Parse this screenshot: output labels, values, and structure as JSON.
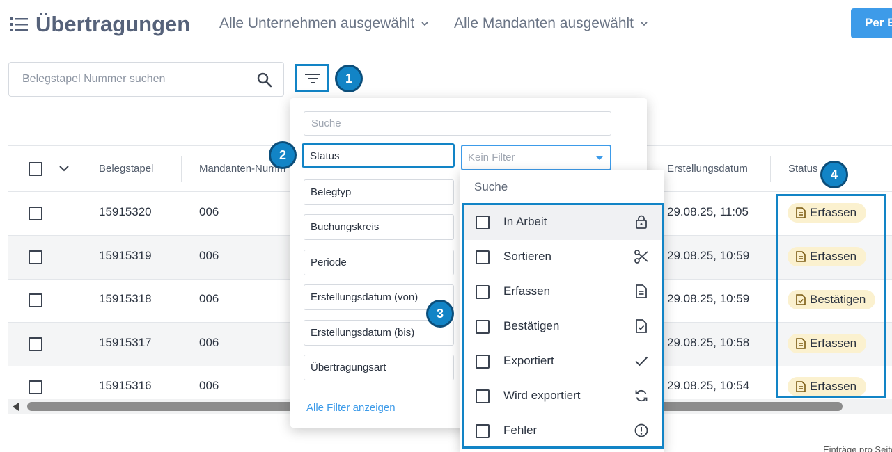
{
  "header": {
    "title": "Übertragungen",
    "company_filter": "Alle Unternehmen ausgewählt",
    "client_filter": "Alle Mandanten ausgewählt",
    "primary_button": "Per E"
  },
  "search": {
    "placeholder": "Belegstapel Nummer suchen"
  },
  "badges": [
    "1",
    "2",
    "3",
    "4"
  ],
  "table": {
    "columns": [
      "Belegstapel",
      "Mandanten-Numm",
      "Erstellungsdatum",
      "Status"
    ],
    "rows": [
      {
        "belegstapel": "15915320",
        "mandant": "006",
        "datum": "29.08.25, 11:05",
        "status": "Erfassen",
        "status_icon": "document-icon"
      },
      {
        "belegstapel": "15915319",
        "mandant": "006",
        "datum": "29.08.25, 10:59",
        "status": "Erfassen",
        "status_icon": "document-icon"
      },
      {
        "belegstapel": "15915318",
        "mandant": "006",
        "datum": "29.08.25, 10:59",
        "status": "Bestätigen",
        "status_icon": "document-check-icon"
      },
      {
        "belegstapel": "15915317",
        "mandant": "006",
        "datum": "29.08.25, 10:58",
        "status": "Erfassen",
        "status_icon": "document-icon"
      },
      {
        "belegstapel": "15915316",
        "mandant": "006",
        "datum": "29.08.25, 10:54",
        "status": "Erfassen",
        "status_icon": "document-icon"
      }
    ]
  },
  "filter_panel": {
    "search_placeholder": "Suche",
    "fields": [
      "Status",
      "Belegtyp",
      "Buchungskreis",
      "Periode",
      "Erstellungsdatum (von)",
      "Erstellungsdatum (bis)",
      "Übertragungsart"
    ],
    "status_select_placeholder": "Kein Filter",
    "show_all_link": "Alle Filter anzeigen"
  },
  "status_dropdown": {
    "search_label": "Suche",
    "options": [
      {
        "label": "In Arbeit",
        "icon": "lock-icon"
      },
      {
        "label": "Sortieren",
        "icon": "scissors-icon"
      },
      {
        "label": "Erfassen",
        "icon": "document-icon"
      },
      {
        "label": "Bestätigen",
        "icon": "document-check-icon"
      },
      {
        "label": "Exportiert",
        "icon": "check-icon"
      },
      {
        "label": "Wird exportiert",
        "icon": "sync-icon"
      },
      {
        "label": "Fehler",
        "icon": "alert-circle-icon"
      }
    ]
  },
  "footer": {
    "pager_text": "Einträge pro Seite"
  },
  "colors": {
    "accent": "#1284c6",
    "primary_button": "#3d9be9",
    "status_chip": "#fbf1cf",
    "title": "#56627a"
  }
}
